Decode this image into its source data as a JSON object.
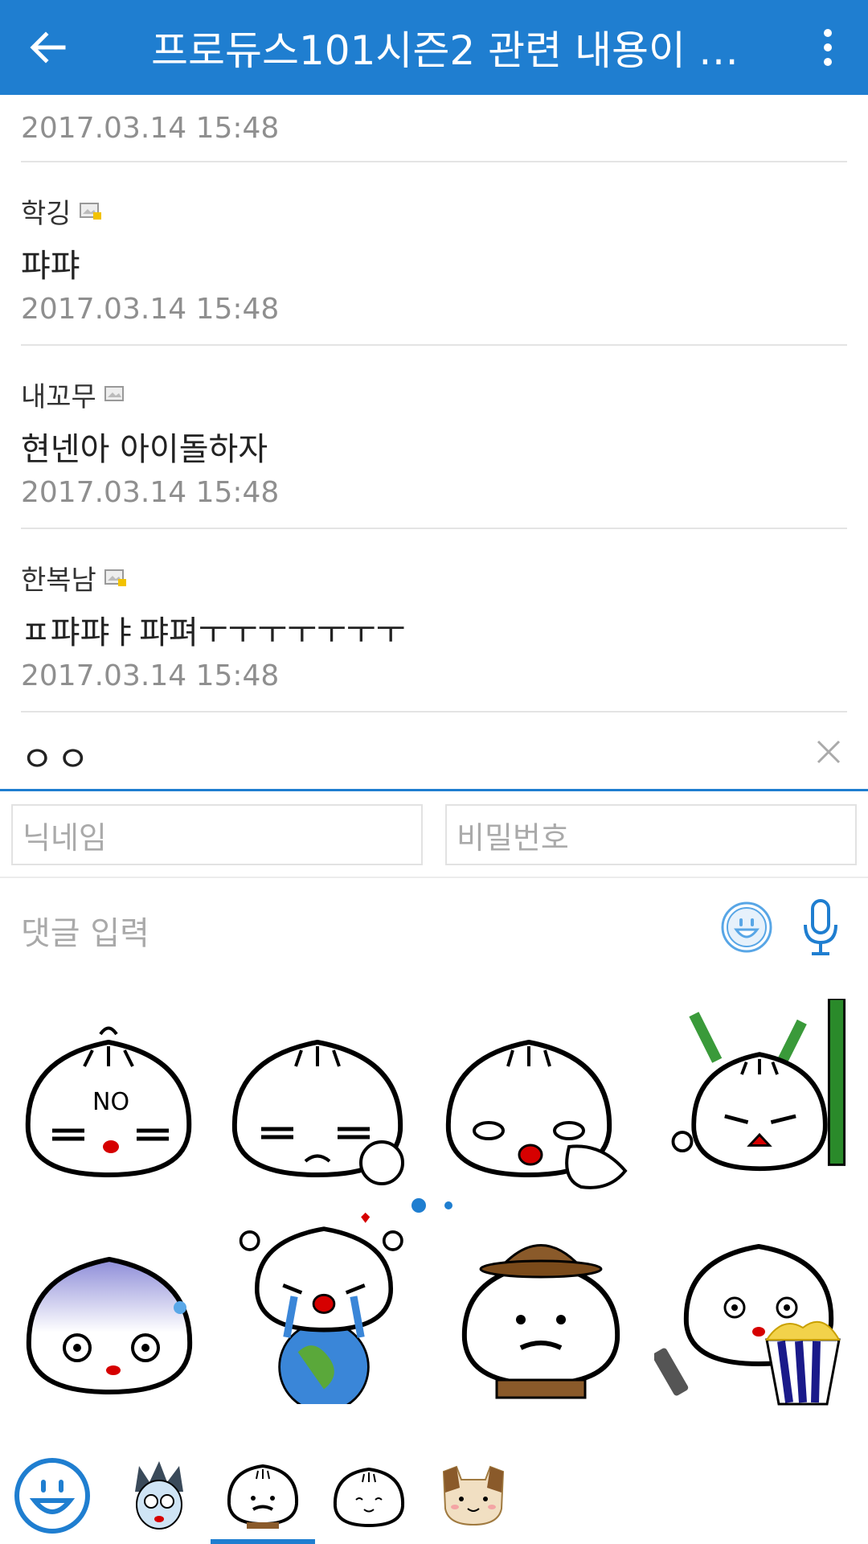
{
  "header": {
    "title": "프로듀스101시즌2 관련 내용이 있…",
    "back_icon": "arrow-left-icon",
    "more_icon": "more-vert-icon"
  },
  "comments": {
    "first_date": "2017.03.14 15:48",
    "items": [
      {
        "author": "학깅",
        "badge": "image-badge-icon",
        "body": "퍄퍄",
        "date": "2017.03.14 15:48"
      },
      {
        "author": "내꼬무",
        "badge": "image-badge-icon",
        "body": "현넨아 아이돌하자",
        "date": "2017.03.14 15:48"
      },
      {
        "author": "한복남",
        "badge": "image-badge-icon",
        "body": "ㅍ퍄퍄ㅑ퍄펴ㅜㅜㅜㅜㅜㅜㅜ",
        "date": "2017.03.14 15:48"
      }
    ]
  },
  "input": {
    "typed_value": "ㅇㅇ",
    "clear_icon": "close-icon"
  },
  "credentials": {
    "nickname_placeholder": "닉네임",
    "password_placeholder": "비밀번호"
  },
  "reply": {
    "placeholder": "댓글 입력",
    "emoji_icon": "smiley-icon",
    "mic_icon": "microphone-icon"
  },
  "stickers": {
    "page": 1,
    "page_count": 2,
    "top_row": [
      "dumpling-no",
      "dumpling-annoyed",
      "dumpling-pointing",
      "dumpling-bamboo"
    ],
    "bottom_row": [
      "dumpling-sweating",
      "dumpling-crying-globe",
      "dumpling-detective",
      "dumpling-popcorn"
    ],
    "no_text": "NO"
  },
  "packs": {
    "selected_index": 2,
    "items": [
      "smiley-pack-icon",
      "spiky-hair-pack-icon",
      "mustache-dumpling-pack-icon",
      "smiling-dumpling-pack-icon",
      "dog-pack-icon"
    ]
  },
  "colors": {
    "accent": "#1f7ed0",
    "muted_text": "#8f8f8f"
  }
}
